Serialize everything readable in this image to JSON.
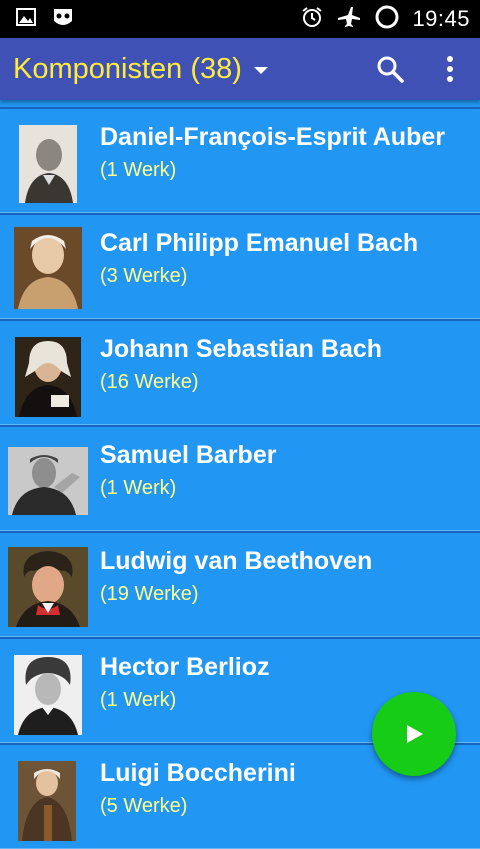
{
  "statusbar": {
    "time": "19:45",
    "icons": [
      "image-icon",
      "incognito-icon",
      "alarm-icon",
      "airplane-mode-icon",
      "loading-icon"
    ]
  },
  "appbar": {
    "title": "Komponisten (38)",
    "search_icon": "search-icon",
    "overflow_icon": "more-vert-icon"
  },
  "composers": [
    {
      "name": "Daniel-François-Esprit Auber",
      "count": "(1 Werk)"
    },
    {
      "name": "Carl Philipp Emanuel Bach",
      "count": "(3 Werke)"
    },
    {
      "name": "Johann Sebastian Bach",
      "count": "(16 Werke)"
    },
    {
      "name": "Samuel Barber",
      "count": "(1 Werk)"
    },
    {
      "name": "Ludwig van Beethoven",
      "count": "(19 Werke)"
    },
    {
      "name": "Hector Berlioz",
      "count": "(1 Werk)"
    },
    {
      "name": "Luigi Boccherini",
      "count": "(5 Werke)"
    }
  ],
  "fab": {
    "icon": "play-icon"
  },
  "colors": {
    "appbar": "#3f51b5",
    "title": "#ffeb3b",
    "list_bg": "#2196f3",
    "count_text": "#ffff8d",
    "fab": "#16cc16"
  }
}
